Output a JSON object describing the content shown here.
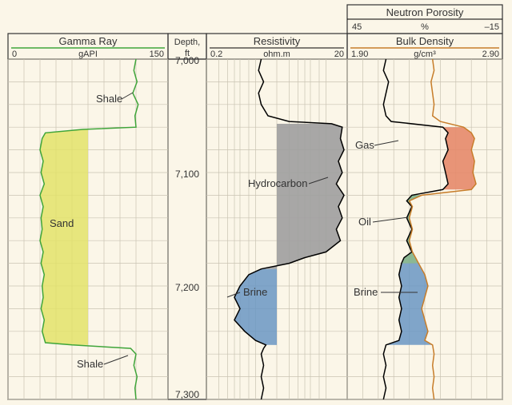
{
  "tracks": {
    "gamma_ray": {
      "title": "Gamma Ray",
      "scale_min": "0",
      "scale_unit": "gAPI",
      "scale_max": "150",
      "labels": {
        "shale_upper": "Shale",
        "sand": "Sand",
        "shale_lower": "Shale"
      }
    },
    "depth": {
      "title": "Depth,\nft",
      "ticks": [
        "7,000",
        "7,100",
        "7,200",
        "7,300"
      ]
    },
    "resistivity": {
      "title": "Resistivity",
      "scale_min": "0.2",
      "scale_unit": "ohm.m",
      "scale_max": "20",
      "labels": {
        "hydrocarbon": "Hydrocarbon",
        "brine": "Brine"
      }
    },
    "neutron": {
      "title": "Neutron Porosity",
      "scale_min": "45",
      "scale_unit": "%",
      "scale_max": "–15"
    },
    "density": {
      "title": "Bulk Density",
      "scale_min": "1.90",
      "scale_unit": "g/cm3",
      "scale_max": "2.90",
      "labels": {
        "gas": "Gas",
        "oil": "Oil",
        "brine": "Brine"
      }
    }
  },
  "chart_data": {
    "type": "line",
    "depth_range_ft": [
      7000,
      7300
    ],
    "series": [
      {
        "name": "Gamma Ray",
        "unit": "gAPI",
        "range": [
          0,
          150
        ],
        "annotations": [
          "Shale",
          "Sand",
          "Shale"
        ],
        "data": [
          [
            7000,
            120
          ],
          [
            7010,
            118
          ],
          [
            7020,
            121
          ],
          [
            7030,
            117
          ],
          [
            7040,
            122
          ],
          [
            7050,
            119
          ],
          [
            7060,
            120
          ],
          [
            7062,
            70
          ],
          [
            7065,
            35
          ],
          [
            7070,
            32
          ],
          [
            7080,
            30
          ],
          [
            7090,
            33
          ],
          [
            7100,
            31
          ],
          [
            7110,
            34
          ],
          [
            7120,
            30
          ],
          [
            7130,
            33
          ],
          [
            7140,
            31
          ],
          [
            7150,
            32
          ],
          [
            7160,
            30
          ],
          [
            7170,
            33
          ],
          [
            7180,
            31
          ],
          [
            7190,
            34
          ],
          [
            7200,
            32
          ],
          [
            7210,
            33
          ],
          [
            7220,
            31
          ],
          [
            7230,
            34
          ],
          [
            7240,
            32
          ],
          [
            7250,
            35
          ],
          [
            7252,
            60
          ],
          [
            7255,
            115
          ],
          [
            7260,
            120
          ],
          [
            7270,
            118
          ],
          [
            7280,
            121
          ],
          [
            7290,
            119
          ],
          [
            7300,
            120
          ]
        ]
      },
      {
        "name": "Resistivity",
        "unit": "ohm.m",
        "range": [
          0.2,
          20
        ],
        "scale": "log",
        "annotations": [
          "Hydrocarbon",
          "Brine"
        ],
        "data": [
          [
            7000,
            1.2
          ],
          [
            7010,
            1.1
          ],
          [
            7020,
            1.3
          ],
          [
            7030,
            1.1
          ],
          [
            7040,
            1.2
          ],
          [
            7050,
            1.5
          ],
          [
            7055,
            3.0
          ],
          [
            7057,
            12
          ],
          [
            7060,
            17
          ],
          [
            7070,
            16
          ],
          [
            7080,
            18
          ],
          [
            7090,
            15
          ],
          [
            7100,
            17
          ],
          [
            7110,
            14
          ],
          [
            7120,
            18
          ],
          [
            7130,
            15
          ],
          [
            7140,
            17
          ],
          [
            7150,
            14
          ],
          [
            7160,
            16
          ],
          [
            7170,
            10
          ],
          [
            7175,
            5
          ],
          [
            7180,
            3
          ],
          [
            7185,
            1.2
          ],
          [
            7190,
            0.8
          ],
          [
            7200,
            0.6
          ],
          [
            7210,
            0.5
          ],
          [
            7220,
            0.6
          ],
          [
            7230,
            0.5
          ],
          [
            7240,
            0.7
          ],
          [
            7248,
            1.0
          ],
          [
            7252,
            1.4
          ],
          [
            7255,
            1.3
          ],
          [
            7260,
            1.2
          ],
          [
            7270,
            1.3
          ],
          [
            7280,
            1.2
          ],
          [
            7290,
            1.3
          ],
          [
            7300,
            1.2
          ]
        ]
      },
      {
        "name": "Neutron Porosity",
        "unit": "%",
        "range": [
          45,
          -15
        ],
        "data": [
          [
            7000,
            30
          ],
          [
            7010,
            31
          ],
          [
            7020,
            29
          ],
          [
            7030,
            30
          ],
          [
            7040,
            31
          ],
          [
            7050,
            30
          ],
          [
            7055,
            28
          ],
          [
            7060,
            8
          ],
          [
            7065,
            6
          ],
          [
            7070,
            7
          ],
          [
            7080,
            6
          ],
          [
            7090,
            8
          ],
          [
            7100,
            7
          ],
          [
            7110,
            6
          ],
          [
            7115,
            8
          ],
          [
            7120,
            20
          ],
          [
            7125,
            22
          ],
          [
            7130,
            20
          ],
          [
            7140,
            22
          ],
          [
            7150,
            20
          ],
          [
            7160,
            22
          ],
          [
            7170,
            20
          ],
          [
            7175,
            23
          ],
          [
            7180,
            24
          ],
          [
            7190,
            25
          ],
          [
            7200,
            24
          ],
          [
            7210,
            25
          ],
          [
            7220,
            24
          ],
          [
            7230,
            25
          ],
          [
            7240,
            24
          ],
          [
            7248,
            25
          ],
          [
            7252,
            30
          ],
          [
            7260,
            31
          ],
          [
            7270,
            30
          ],
          [
            7280,
            31
          ],
          [
            7290,
            30
          ],
          [
            7300,
            31
          ]
        ]
      },
      {
        "name": "Bulk Density",
        "unit": "g/cm3",
        "range": [
          1.9,
          2.9
        ],
        "annotations": [
          "Gas",
          "Oil",
          "Brine"
        ],
        "data": [
          [
            7000,
            2.45
          ],
          [
            7010,
            2.46
          ],
          [
            7020,
            2.44
          ],
          [
            7030,
            2.45
          ],
          [
            7040,
            2.46
          ],
          [
            7050,
            2.45
          ],
          [
            7055,
            2.5
          ],
          [
            7060,
            2.65
          ],
          [
            7065,
            2.7
          ],
          [
            7070,
            2.72
          ],
          [
            7080,
            2.7
          ],
          [
            7090,
            2.72
          ],
          [
            7100,
            2.71
          ],
          [
            7110,
            2.73
          ],
          [
            7115,
            2.7
          ],
          [
            7120,
            2.38
          ],
          [
            7125,
            2.3
          ],
          [
            7130,
            2.32
          ],
          [
            7140,
            2.3
          ],
          [
            7150,
            2.32
          ],
          [
            7160,
            2.3
          ],
          [
            7170,
            2.32
          ],
          [
            7175,
            2.34
          ],
          [
            7180,
            2.36
          ],
          [
            7190,
            2.4
          ],
          [
            7200,
            2.42
          ],
          [
            7210,
            2.4
          ],
          [
            7220,
            2.38
          ],
          [
            7230,
            2.4
          ],
          [
            7240,
            2.42
          ],
          [
            7248,
            2.4
          ],
          [
            7252,
            2.45
          ],
          [
            7260,
            2.46
          ],
          [
            7270,
            2.45
          ],
          [
            7280,
            2.46
          ],
          [
            7290,
            2.45
          ],
          [
            7300,
            2.46
          ]
        ]
      }
    ],
    "fluid_zones": [
      {
        "track": "Resistivity",
        "name": "Hydrocarbon",
        "top_ft": 7057,
        "base_ft": 7185
      },
      {
        "track": "Resistivity",
        "name": "Brine",
        "top_ft": 7185,
        "base_ft": 7252
      },
      {
        "track": "Density/Neutron",
        "name": "Gas",
        "top_ft": 7057,
        "base_ft": 7118
      },
      {
        "track": "Density/Neutron",
        "name": "Oil",
        "top_ft": 7118,
        "base_ft": 7180
      },
      {
        "track": "Density/Neutron",
        "name": "Brine",
        "top_ft": 7180,
        "base_ft": 7252
      }
    ]
  }
}
